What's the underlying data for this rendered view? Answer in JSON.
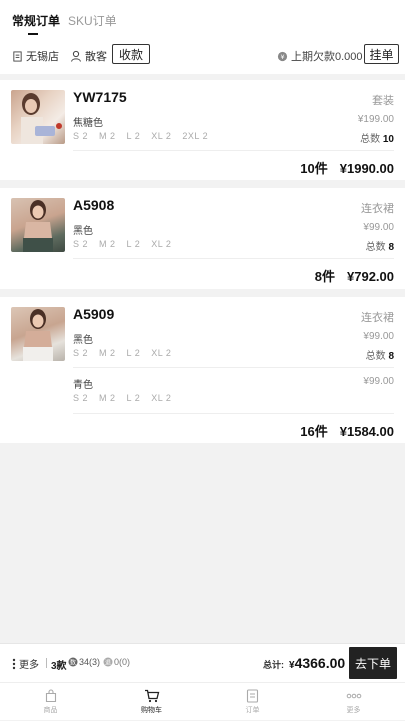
{
  "tabs": {
    "regular": "常规订单",
    "sku": "SKU订单"
  },
  "toolbar": {
    "store": "无锡店",
    "customer": "散客",
    "collect": "收款",
    "last_debt": "上期欠款0.000",
    "hold": "挂单"
  },
  "items": [
    {
      "code": "YW7175",
      "category": "套装",
      "variants": [
        {
          "color": "焦糖色",
          "sizes": [
            "S 2",
            "M 2",
            "L 2",
            "XL 2",
            "2XL 2"
          ],
          "price": "¥199.00",
          "total_label": "总数",
          "total": "10"
        }
      ],
      "qty": "10件",
      "amount": "¥1990.00"
    },
    {
      "code": "A5908",
      "category": "连衣裙",
      "variants": [
        {
          "color": "黑色",
          "sizes": [
            "S 2",
            "M 2",
            "L 2",
            "XL 2"
          ],
          "price": "¥99.00",
          "total_label": "总数",
          "total": "8"
        }
      ],
      "qty": "8件",
      "amount": "¥792.00"
    },
    {
      "code": "A5909",
      "category": "连衣裙",
      "variants": [
        {
          "color": "黑色",
          "sizes": [
            "S 2",
            "M 2",
            "L 2",
            "XL 2"
          ],
          "price": "¥99.00",
          "total_label": "总数",
          "total": "8"
        },
        {
          "color": "青色",
          "sizes": [
            "S 2",
            "M 2",
            "L 2",
            "XL 2"
          ],
          "price": "¥99.00"
        }
      ],
      "qty": "16件",
      "amount": "¥1584.00"
    }
  ],
  "bottom": {
    "more": "更多",
    "styles": "3款",
    "count_a": "34(3)",
    "count_b": "0(0)",
    "total_label": "总计:",
    "total_symbol": "¥",
    "total_value": "4366.00",
    "checkout": "去下单"
  },
  "nav": {
    "goods": "商品",
    "cart": "购物车",
    "orders": "订单",
    "more": "更多"
  },
  "colors": {
    "accent": "#222222",
    "background": "#f2f2f2",
    "muted": "#999999"
  }
}
